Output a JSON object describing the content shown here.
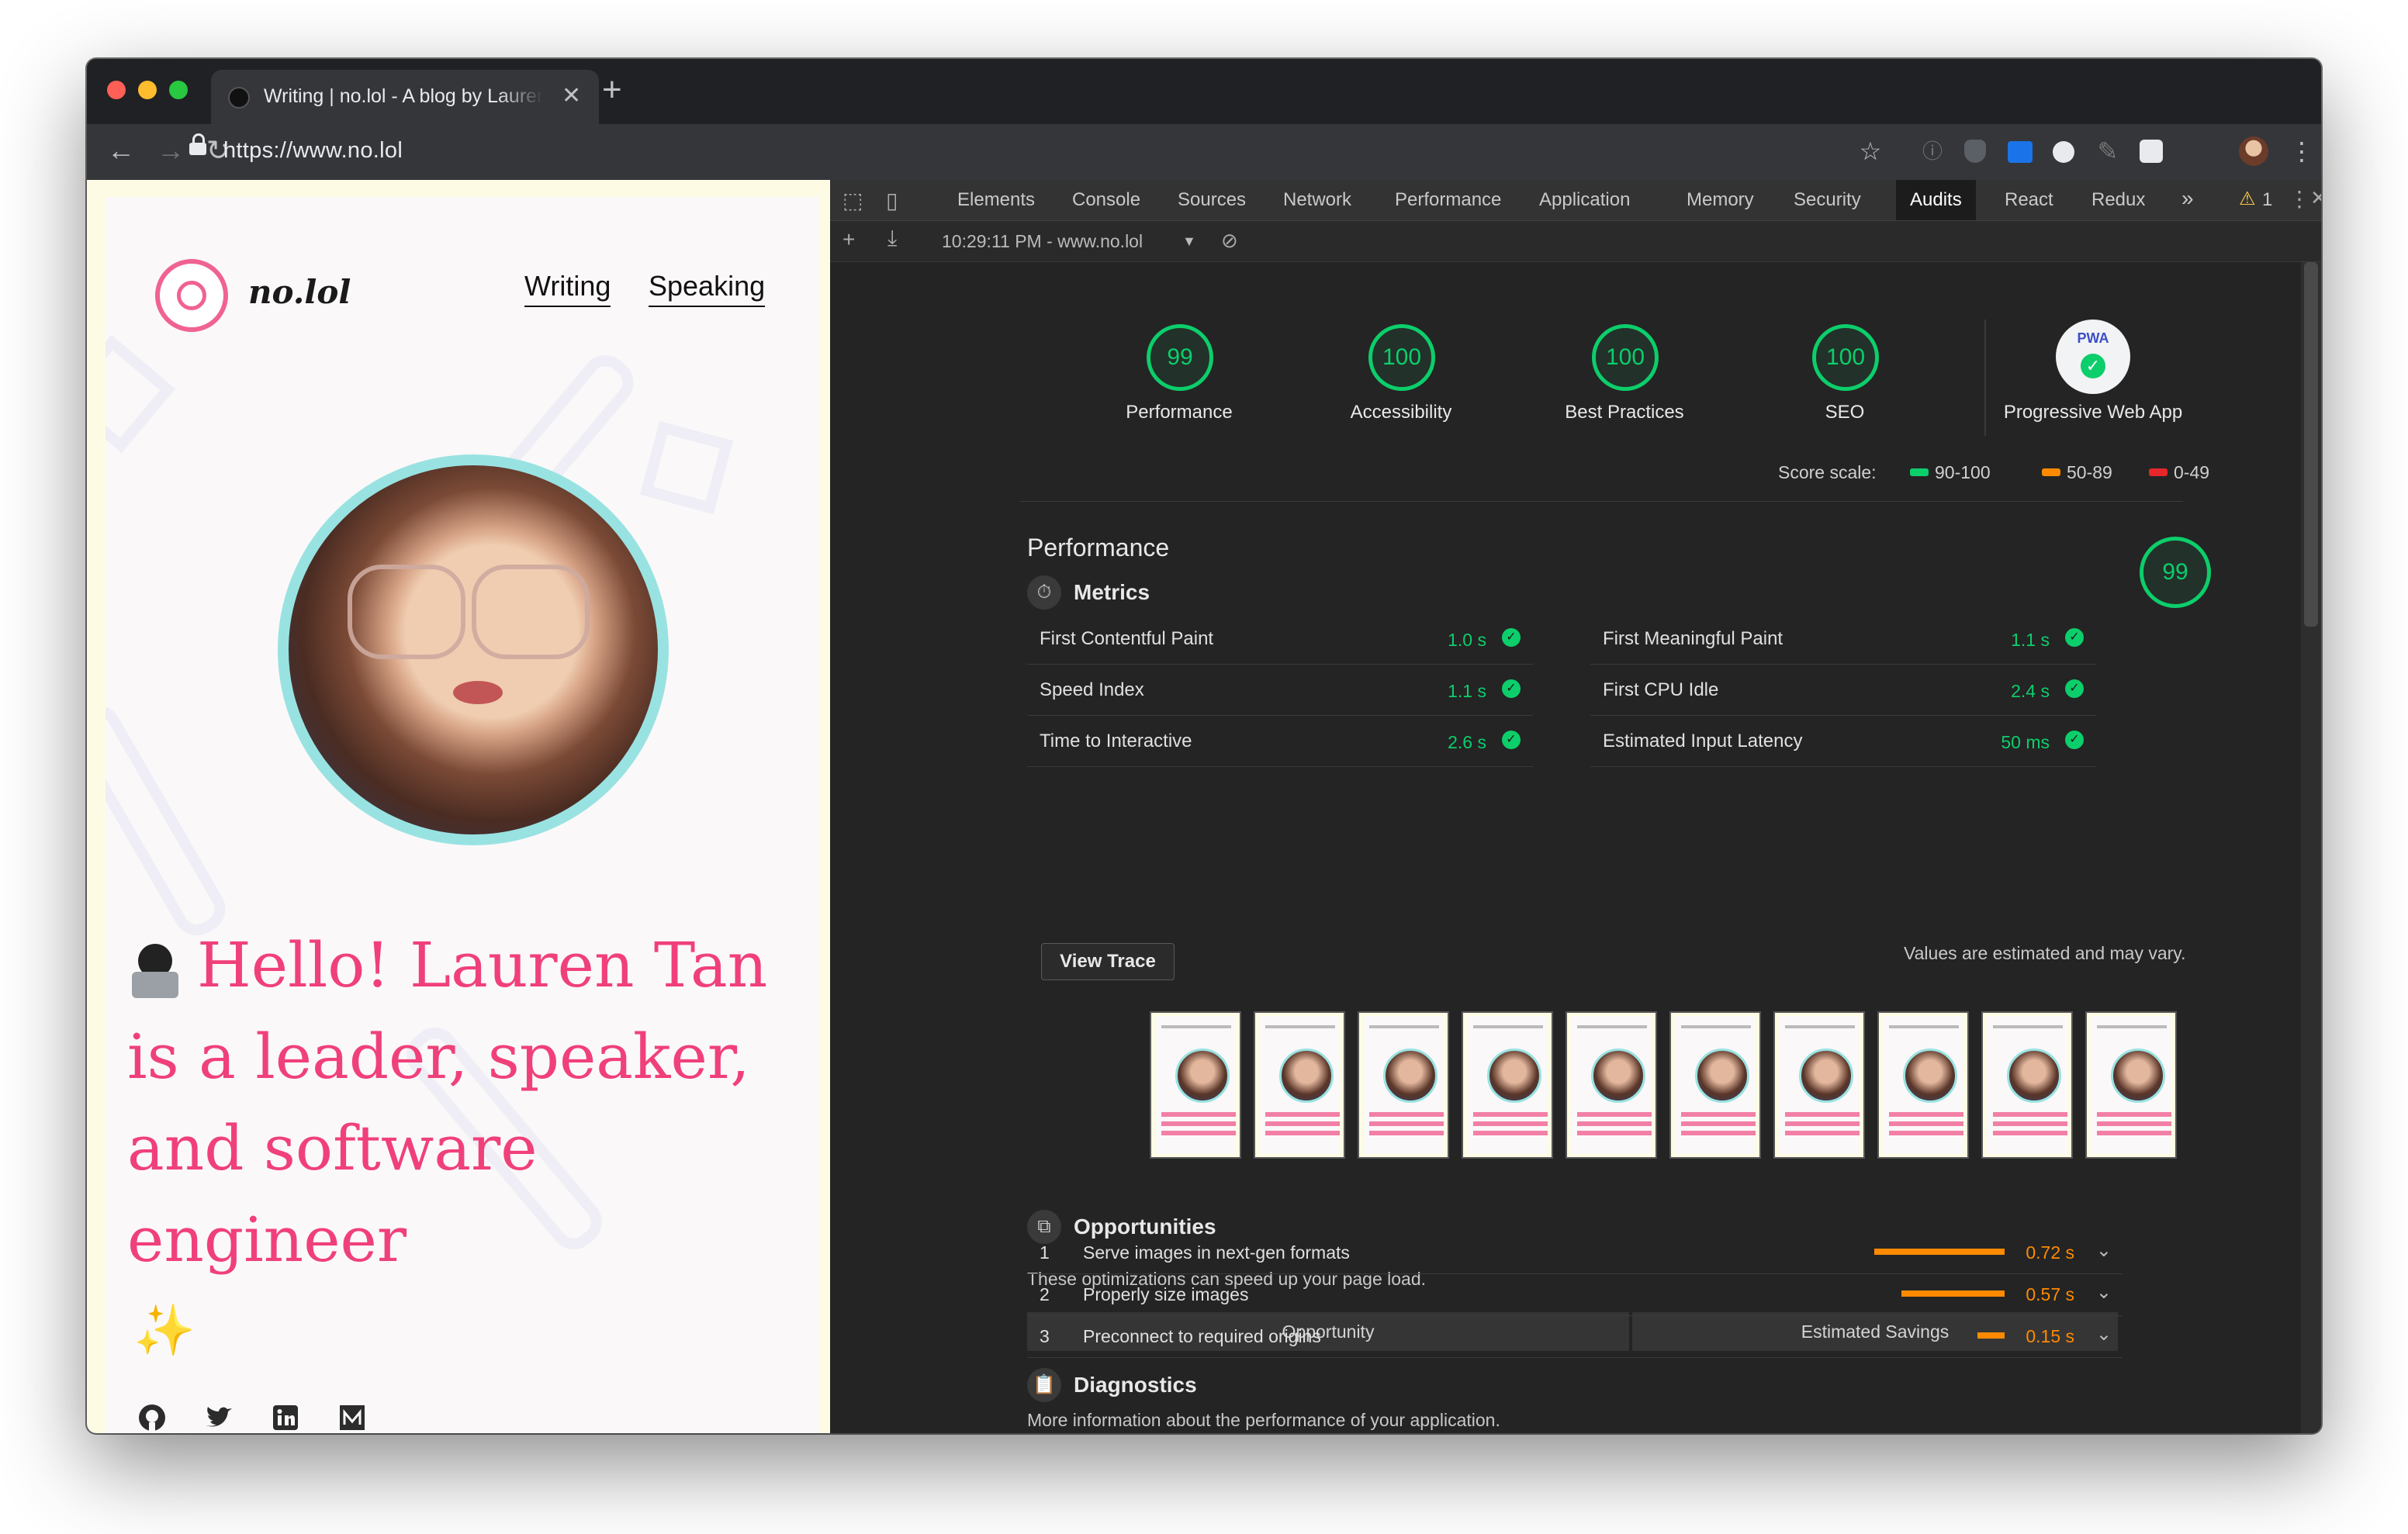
{
  "browser": {
    "tab_title": "Writing | no.lol - A blog by Lauren Tan",
    "tab_close": "✕",
    "new_tab": "+",
    "url": "https://www.no.lol"
  },
  "site": {
    "brand": "no.lol",
    "nav": {
      "writing": "Writing",
      "speaking": "Speaking"
    },
    "headline": "Hello! Lauren Tan is a leader, speaker, and software engineer",
    "sparkles": "✨",
    "social": [
      "github-icon",
      "twitter-icon",
      "linkedin-icon",
      "medium-icon"
    ]
  },
  "devtools": {
    "tabs": [
      "Elements",
      "Console",
      "Sources",
      "Network",
      "Performance",
      "Application",
      "Memory",
      "Security",
      "Audits",
      "React",
      "Redux"
    ],
    "more_tabs": "»",
    "warning_count": "1",
    "report_selector": "10:29:11 PM - www.no.lol"
  },
  "audits": {
    "categories": [
      {
        "score": "99",
        "label": "Performance"
      },
      {
        "score": "100",
        "label": "Accessibility"
      },
      {
        "score": "100",
        "label": "Best Practices"
      },
      {
        "score": "100",
        "label": "SEO"
      }
    ],
    "pwa": {
      "badge": "PWA",
      "label": "Progressive Web App"
    },
    "score_scale": {
      "title": "Score scale:",
      "high": "90-100",
      "mid": "50-89",
      "low": "0-49"
    },
    "colors": {
      "pass": "#0cce6b",
      "average": "#ff8a00",
      "fail": "#e5262a"
    },
    "performance": {
      "title": "Performance",
      "score": "99",
      "metrics_title": "Metrics",
      "metrics": [
        {
          "label": "First Contentful Paint",
          "value": "1.0 s"
        },
        {
          "label": "First Meaningful Paint",
          "value": "1.1 s"
        },
        {
          "label": "Speed Index",
          "value": "1.1 s"
        },
        {
          "label": "First CPU Idle",
          "value": "2.4 s"
        },
        {
          "label": "Time to Interactive",
          "value": "2.6 s"
        },
        {
          "label": "Estimated Input Latency",
          "value": "50 ms"
        }
      ],
      "view_trace": "View Trace",
      "estimate_note": "Values are estimated and may vary."
    },
    "opportunities": {
      "title": "Opportunities",
      "description": "These optimizations can speed up your page load.",
      "col_opportunity": "Opportunity",
      "col_savings": "Estimated Savings",
      "rows": [
        {
          "num": "1",
          "label": "Serve images in next-gen formats",
          "savings": "0.72 s",
          "savings_seconds": 0.72
        },
        {
          "num": "2",
          "label": "Properly size images",
          "savings": "0.57 s",
          "savings_seconds": 0.57
        },
        {
          "num": "3",
          "label": "Preconnect to required origins",
          "savings": "0.15 s",
          "savings_seconds": 0.15
        }
      ]
    },
    "diagnostics": {
      "title": "Diagnostics",
      "description": "More information about the performance of your application."
    }
  }
}
